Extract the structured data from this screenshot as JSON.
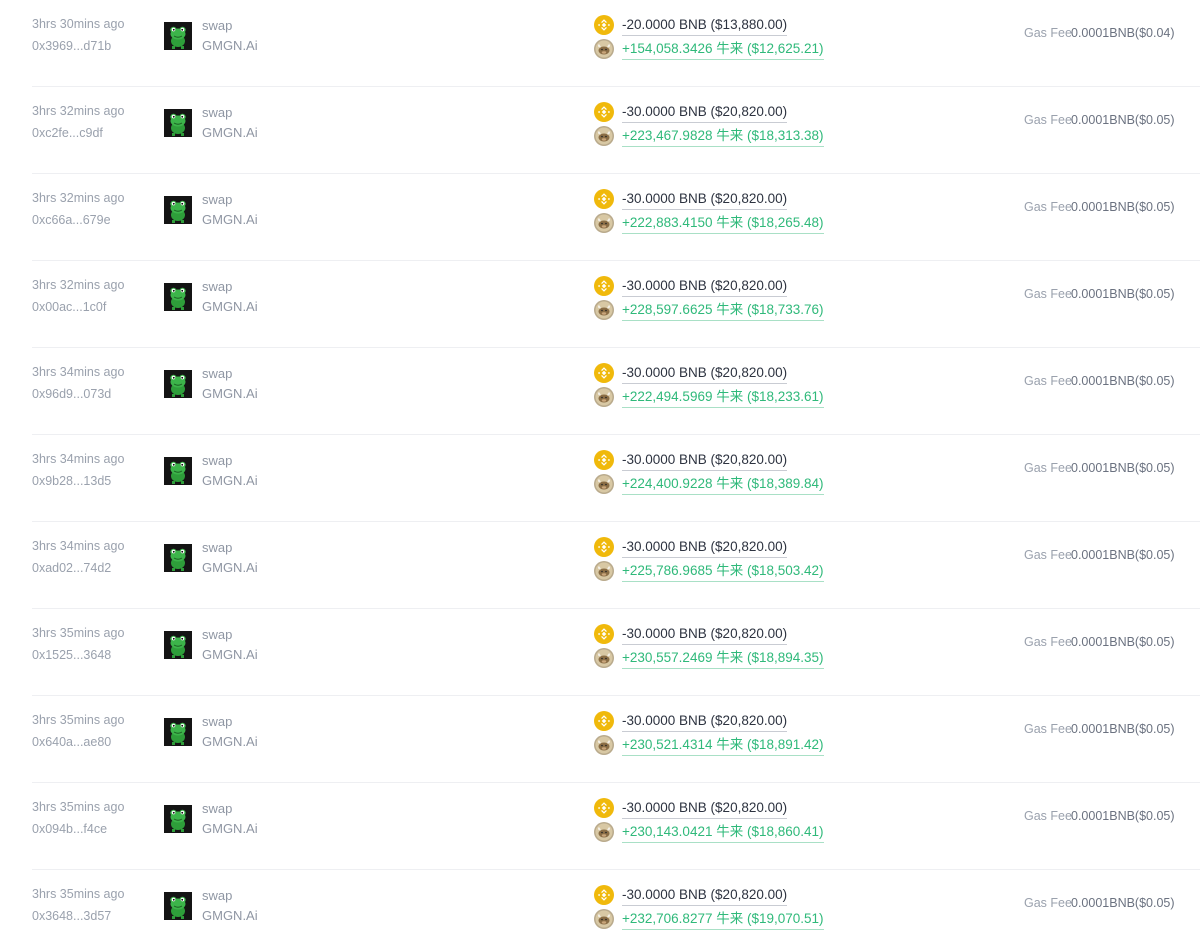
{
  "labels": {
    "gas_fee": "Gas Fee"
  },
  "colors": {
    "text_muted": "#9aa1ad",
    "text_dark": "#2d3340",
    "text_green": "#2fb97a",
    "bnb_yellow": "#f0b90b",
    "divider": "#eeeff2"
  },
  "icons": {
    "avatar": "green-frog-avatar-icon",
    "out_token": "bnb-coin-icon",
    "in_token": "token-coin-icon"
  },
  "transactions": [
    {
      "time": "3hrs 30mins ago",
      "hash": "0x3969...d71b",
      "action": "swap",
      "platform": "GMGN.Ai",
      "out": "-20.0000 BNB ($13,880.00)",
      "in": "+154,058.3426 牛来 ($12,625.21)",
      "gas": "0.0001BNB($0.04)"
    },
    {
      "time": "3hrs 32mins ago",
      "hash": "0xc2fe...c9df",
      "action": "swap",
      "platform": "GMGN.Ai",
      "out": "-30.0000 BNB ($20,820.00)",
      "in": "+223,467.9828 牛来 ($18,313.38)",
      "gas": "0.0001BNB($0.05)"
    },
    {
      "time": "3hrs 32mins ago",
      "hash": "0xc66a...679e",
      "action": "swap",
      "platform": "GMGN.Ai",
      "out": "-30.0000 BNB ($20,820.00)",
      "in": "+222,883.4150 牛来 ($18,265.48)",
      "gas": "0.0001BNB($0.05)"
    },
    {
      "time": "3hrs 32mins ago",
      "hash": "0x00ac...1c0f",
      "action": "swap",
      "platform": "GMGN.Ai",
      "out": "-30.0000 BNB ($20,820.00)",
      "in": "+228,597.6625 牛来 ($18,733.76)",
      "gas": "0.0001BNB($0.05)"
    },
    {
      "time": "3hrs 34mins ago",
      "hash": "0x96d9...073d",
      "action": "swap",
      "platform": "GMGN.Ai",
      "out": "-30.0000 BNB ($20,820.00)",
      "in": "+222,494.5969 牛来 ($18,233.61)",
      "gas": "0.0001BNB($0.05)"
    },
    {
      "time": "3hrs 34mins ago",
      "hash": "0x9b28...13d5",
      "action": "swap",
      "platform": "GMGN.Ai",
      "out": "-30.0000 BNB ($20,820.00)",
      "in": "+224,400.9228 牛来 ($18,389.84)",
      "gas": "0.0001BNB($0.05)"
    },
    {
      "time": "3hrs 34mins ago",
      "hash": "0xad02...74d2",
      "action": "swap",
      "platform": "GMGN.Ai",
      "out": "-30.0000 BNB ($20,820.00)",
      "in": "+225,786.9685 牛来 ($18,503.42)",
      "gas": "0.0001BNB($0.05)"
    },
    {
      "time": "3hrs 35mins ago",
      "hash": "0x1525...3648",
      "action": "swap",
      "platform": "GMGN.Ai",
      "out": "-30.0000 BNB ($20,820.00)",
      "in": "+230,557.2469 牛来 ($18,894.35)",
      "gas": "0.0001BNB($0.05)"
    },
    {
      "time": "3hrs 35mins ago",
      "hash": "0x640a...ae80",
      "action": "swap",
      "platform": "GMGN.Ai",
      "out": "-30.0000 BNB ($20,820.00)",
      "in": "+230,521.4314 牛来 ($18,891.42)",
      "gas": "0.0001BNB($0.05)"
    },
    {
      "time": "3hrs 35mins ago",
      "hash": "0x094b...f4ce",
      "action": "swap",
      "platform": "GMGN.Ai",
      "out": "-30.0000 BNB ($20,820.00)",
      "in": "+230,143.0421 牛来 ($18,860.41)",
      "gas": "0.0001BNB($0.05)"
    },
    {
      "time": "3hrs 35mins ago",
      "hash": "0x3648...3d57",
      "action": "swap",
      "platform": "GMGN.Ai",
      "out": "-30.0000 BNB ($20,820.00)",
      "in": "+232,706.8277 牛来 ($19,070.51)",
      "gas": "0.0001BNB($0.05)"
    }
  ]
}
